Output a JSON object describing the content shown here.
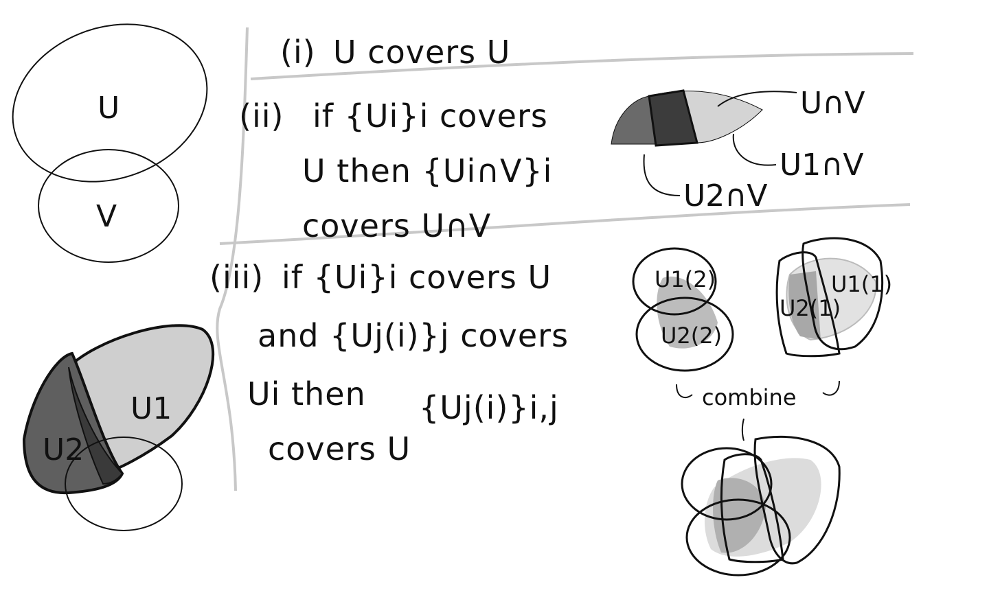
{
  "venn": {
    "u_label": "U",
    "v_label": "V"
  },
  "axiom_i": {
    "marker": "(i)",
    "text": "U covers U"
  },
  "axiom_ii": {
    "marker": "(ii)",
    "line1": "if {Ui}i covers",
    "line2": "U then {Ui∩V}i",
    "line3": "covers U∩V",
    "label_unv": "U∩V",
    "label_u1nv": "U1∩V",
    "label_u2nv": "U2∩V"
  },
  "axiom_iii": {
    "marker": "(iii)",
    "line1": "if {Ui}i covers U",
    "line2": "and {Uj(i)}j covers",
    "line3": "Ui then",
    "line3b": "{Uj(i)}i,j",
    "line4": "covers U"
  },
  "cover_left": {
    "label_u1": "U1",
    "label_u2": "U2"
  },
  "cover_sets": {
    "u1_2": "U1(2)",
    "u2_2": "U2(2)",
    "u1_1": "U1(1)",
    "u2_1": "U2(1)",
    "combine": "combine"
  },
  "colors": {
    "ink": "#111111",
    "divider": "#c8c8c8",
    "dark": "#5f5f5f",
    "mid": "#9a9a9a",
    "light": "#d9d9d9",
    "pale": "#e8e8e8"
  }
}
